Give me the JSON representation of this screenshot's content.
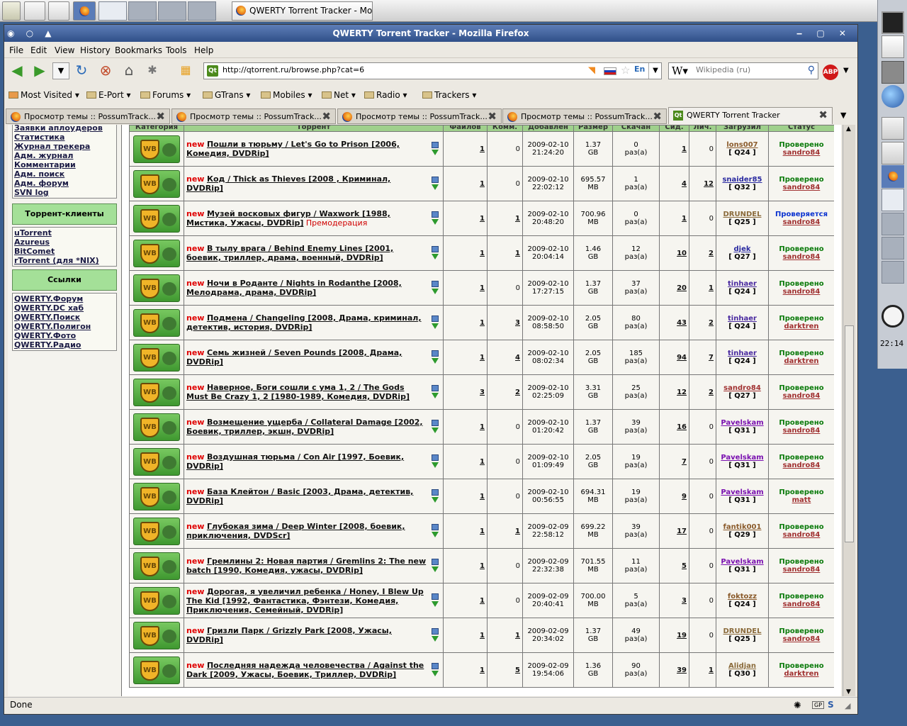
{
  "taskbar": {
    "task_title": "QWERTY Torrent Tracker - Mo..."
  },
  "window": {
    "title": "QWERTY Torrent Tracker - Mozilla Firefox"
  },
  "menu": [
    "File",
    "Edit",
    "View",
    "History",
    "Bookmarks",
    "Tools",
    "Help"
  ],
  "url": "http://qtorrent.ru/browse.php?cat=6",
  "search": {
    "placeholder": "Wikipedia (ru)"
  },
  "bookmarks": [
    "Most Visited",
    "E-Port",
    "Forums",
    "GTrans",
    "Mobiles",
    "Net",
    "Radio",
    "Trackers"
  ],
  "tabs": [
    {
      "label": "Просмотр темы :: PossumTrack..."
    },
    {
      "label": "Просмотр темы :: PossumTrack..."
    },
    {
      "label": "Просмотр темы :: PossumTrack..."
    },
    {
      "label": "Просмотр темы :: PossumTrack..."
    },
    {
      "label": "QWERTY Torrent Tracker"
    }
  ],
  "sidebar": {
    "admin_links": [
      "Заявки аплоудеров",
      "Статистика",
      "Журнал трекера",
      "Адм. журнал",
      "Комментарии",
      "Адм. поиск",
      "Адм. форум",
      "SVN log"
    ],
    "clients_header": "Торрент-клиенты",
    "clients": [
      "uTorrent",
      "Azureus",
      "BitComet",
      "rTorrent (для *NIX)"
    ],
    "links_header": "Ссылки",
    "links": [
      "QWERTY.Форум",
      "QWERTY.DC хаб",
      "QWERTY.Поиск",
      "QWERTY.Полигон",
      "QWERTY.Фото",
      "QWERTY.Радио"
    ]
  },
  "table": {
    "headers": [
      "Категория",
      "Торрент",
      "Файлов",
      "Комм.",
      "Добавлен",
      "Размер",
      "Скачан",
      "Сид.",
      "Лич.",
      "Загрузил",
      "Статус"
    ],
    "category_icon": "WB",
    "rows": [
      {
        "new": "new",
        "title": "Пошли в тюрьму / Let's Go to Prison [2006, Комедия, DVDRip]",
        "pre": "",
        "files": "1",
        "comm": "0",
        "date": "2009-02-10",
        "time": "21:24:20",
        "size": "1.37",
        "unit": "GB",
        "dl": "0",
        "dlu": "раз(а)",
        "seed": "1",
        "leech": "0",
        "up": "lons007",
        "upc": "#8a5a2a",
        "rank": "[ Q24 ]",
        "status": "Проверено",
        "mod": "sandro84"
      },
      {
        "new": "new",
        "title": "Код / Thick as Thieves [2008 , Криминал, DVDRip]",
        "pre": "",
        "files": "1",
        "comm": "0",
        "date": "2009-02-10",
        "time": "22:02:12",
        "size": "695.57",
        "unit": "MB",
        "dl": "1",
        "dlu": "раз(а)",
        "seed": "4",
        "leech": "12",
        "up": "snaider85",
        "upc": "#2a2aa0",
        "rank": "[ Q32 ]",
        "status": "Проверено",
        "mod": "sandro84"
      },
      {
        "new": "new",
        "title": "Музей восковых фигур / Waxwork [1988, Мистика, Ужасы, DVDRip]",
        "pre": "Премодерация",
        "files": "1",
        "comm": "1",
        "date": "2009-02-10",
        "time": "20:48:20",
        "size": "700.96",
        "unit": "MB",
        "dl": "0",
        "dlu": "раз(а)",
        "seed": "1",
        "leech": "0",
        "up": "DRUNDEL",
        "upc": "#8a6a3a",
        "rank": "[ Q25 ]",
        "status": "Проверяется",
        "mod": "sandro84"
      },
      {
        "new": "new",
        "title": "В тылу врага / Behind Enemy Lines [2001, боевик, триллер, драма, военный, DVDRip]",
        "pre": "",
        "files": "1",
        "comm": "1",
        "date": "2009-02-10",
        "time": "20:04:14",
        "size": "1.46",
        "unit": "GB",
        "dl": "12",
        "dlu": "раз(а)",
        "seed": "10",
        "leech": "2",
        "up": "djek",
        "upc": "#2a2aa0",
        "rank": "[ Q27 ]",
        "status": "Проверено",
        "mod": "sandro84"
      },
      {
        "new": "new",
        "title": "Ночи в Роданте / Nights in Rodanthe [2008, Мелодрама, драма, DVDRip]",
        "pre": "",
        "files": "1",
        "comm": "0",
        "date": "2009-02-10",
        "time": "17:27:15",
        "size": "1.37",
        "unit": "GB",
        "dl": "37",
        "dlu": "раз(а)",
        "seed": "20",
        "leech": "1",
        "up": "tinhaer",
        "upc": "#4a2aa0",
        "rank": "[ Q24 ]",
        "status": "Проверено",
        "mod": "sandro84"
      },
      {
        "new": "new",
        "title": "Подмена / Changeling [2008, Драма, криминал, детектив, история, DVDRip]",
        "pre": "",
        "files": "1",
        "comm": "3",
        "date": "2009-02-10",
        "time": "08:58:50",
        "size": "2.05",
        "unit": "GB",
        "dl": "80",
        "dlu": "раз(а)",
        "seed": "43",
        "leech": "2",
        "up": "tinhaer",
        "upc": "#4a2aa0",
        "rank": "[ Q24 ]",
        "status": "Проверено",
        "mod": "darktren"
      },
      {
        "new": "new",
        "title": "Семь жизней / Seven Pounds [2008, Драма, DVDRip]",
        "pre": "",
        "files": "1",
        "comm": "4",
        "date": "2009-02-10",
        "time": "08:02:34",
        "size": "2.05",
        "unit": "GB",
        "dl": "185",
        "dlu": "раз(а)",
        "seed": "94",
        "leech": "7",
        "up": "tinhaer",
        "upc": "#4a2aa0",
        "rank": "[ Q24 ]",
        "status": "Проверено",
        "mod": "darktren"
      },
      {
        "new": "new",
        "title": "Наверное, Боги сошли с ума 1, 2 / The Gods Must Be Crazy 1, 2 [1980-1989, Комедия, DVDRip]",
        "pre": "",
        "files": "3",
        "comm": "2",
        "date": "2009-02-10",
        "time": "02:25:09",
        "size": "3.31",
        "unit": "GB",
        "dl": "25",
        "dlu": "раз(а)",
        "seed": "12",
        "leech": "2",
        "up": "sandro84",
        "upc": "#a03030",
        "rank": "[ Q27 ]",
        "status": "Проверено",
        "mod": "sandro84"
      },
      {
        "new": "new",
        "title": "Возмещение ущерба / Collateral Damage [2002, Боевик, триллер, экшн, DVDRip]",
        "pre": "",
        "files": "1",
        "comm": "0",
        "date": "2009-02-10",
        "time": "01:20:42",
        "size": "1.37",
        "unit": "GB",
        "dl": "39",
        "dlu": "раз(а)",
        "seed": "16",
        "leech": "0",
        "up": "Pavelskam",
        "upc": "#7a10b0",
        "rank": "[ Q31 ]",
        "status": "Проверено",
        "mod": "sandro84"
      },
      {
        "new": "new",
        "title": "Воздушная тюрьма / Con Air [1997, Боевик, DVDRip]",
        "pre": "",
        "files": "1",
        "comm": "0",
        "date": "2009-02-10",
        "time": "01:09:49",
        "size": "2.05",
        "unit": "GB",
        "dl": "19",
        "dlu": "раз(а)",
        "seed": "7",
        "leech": "0",
        "up": "Pavelskam",
        "upc": "#7a10b0",
        "rank": "[ Q31 ]",
        "status": "Проверено",
        "mod": "sandro84"
      },
      {
        "new": "new",
        "title": "База Клейтон / Basic [2003, Драма, детектив, DVDRip]",
        "pre": "",
        "files": "1",
        "comm": "0",
        "date": "2009-02-10",
        "time": "00:56:55",
        "size": "694.31",
        "unit": "MB",
        "dl": "19",
        "dlu": "раз(а)",
        "seed": "9",
        "leech": "0",
        "up": "Pavelskam",
        "upc": "#7a10b0",
        "rank": "[ Q31 ]",
        "status": "Проверено",
        "mod": "matt"
      },
      {
        "new": "new",
        "title": "Глубокая зима / Deep Winter [2008, боевик, приключения, DVDScr]",
        "pre": "",
        "files": "1",
        "comm": "1",
        "date": "2009-02-09",
        "time": "22:58:12",
        "size": "699.22",
        "unit": "MB",
        "dl": "39",
        "dlu": "раз(а)",
        "seed": "17",
        "leech": "0",
        "up": "fantik001",
        "upc": "#8a5a2a",
        "rank": "[ Q29 ]",
        "status": "Проверено",
        "mod": "sandro84"
      },
      {
        "new": "new",
        "title": "Гремлины 2: Новая партия / Gremlins 2: The new batch [1990, Комедия, ужасы, DVDRip]",
        "pre": "",
        "files": "1",
        "comm": "0",
        "date": "2009-02-09",
        "time": "22:32:38",
        "size": "701.55",
        "unit": "MB",
        "dl": "11",
        "dlu": "раз(а)",
        "seed": "5",
        "leech": "0",
        "up": "Pavelskam",
        "upc": "#7a10b0",
        "rank": "[ Q31 ]",
        "status": "Проверено",
        "mod": "sandro84"
      },
      {
        "new": "new",
        "title": "Дорогая, я увеличил ребенка / Honey, I Blew Up The Kid [1992, Фантастика, Фэнтези, Комедия, Приключения, Семейный, DVDRip]",
        "pre": "",
        "files": "1",
        "comm": "0",
        "date": "2009-02-09",
        "time": "20:40:41",
        "size": "700.00",
        "unit": "MB",
        "dl": "5",
        "dlu": "раз(а)",
        "seed": "3",
        "leech": "0",
        "up": "foktozz",
        "upc": "#8a5a2a",
        "rank": "[ Q24 ]",
        "status": "Проверено",
        "mod": "sandro84"
      },
      {
        "new": "new",
        "title": "Гризли Парк / Grizzly Park [2008, Ужасы, DVDRip]",
        "pre": "",
        "files": "1",
        "comm": "1",
        "date": "2009-02-09",
        "time": "20:34:02",
        "size": "1.37",
        "unit": "GB",
        "dl": "49",
        "dlu": "раз(а)",
        "seed": "19",
        "leech": "0",
        "up": "DRUNDEL",
        "upc": "#8a6a3a",
        "rank": "[ Q25 ]",
        "status": "Проверено",
        "mod": "sandro84"
      },
      {
        "new": "new",
        "title": "Последняя надежда человечества / Against the Dark [2009, Ужасы, Боевик, Триллер, DVDRip]",
        "pre": "",
        "files": "1",
        "comm": "5",
        "date": "2009-02-09",
        "time": "19:54:06",
        "size": "1.36",
        "unit": "GB",
        "dl": "90",
        "dlu": "раз(а)",
        "seed": "39",
        "leech": "1",
        "up": "Alidjan",
        "upc": "#8a6a3a",
        "rank": "[ Q30 ]",
        "status": "Проверено",
        "mod": "darktren"
      }
    ]
  },
  "status": {
    "text": "Done"
  },
  "clock": "22:14"
}
